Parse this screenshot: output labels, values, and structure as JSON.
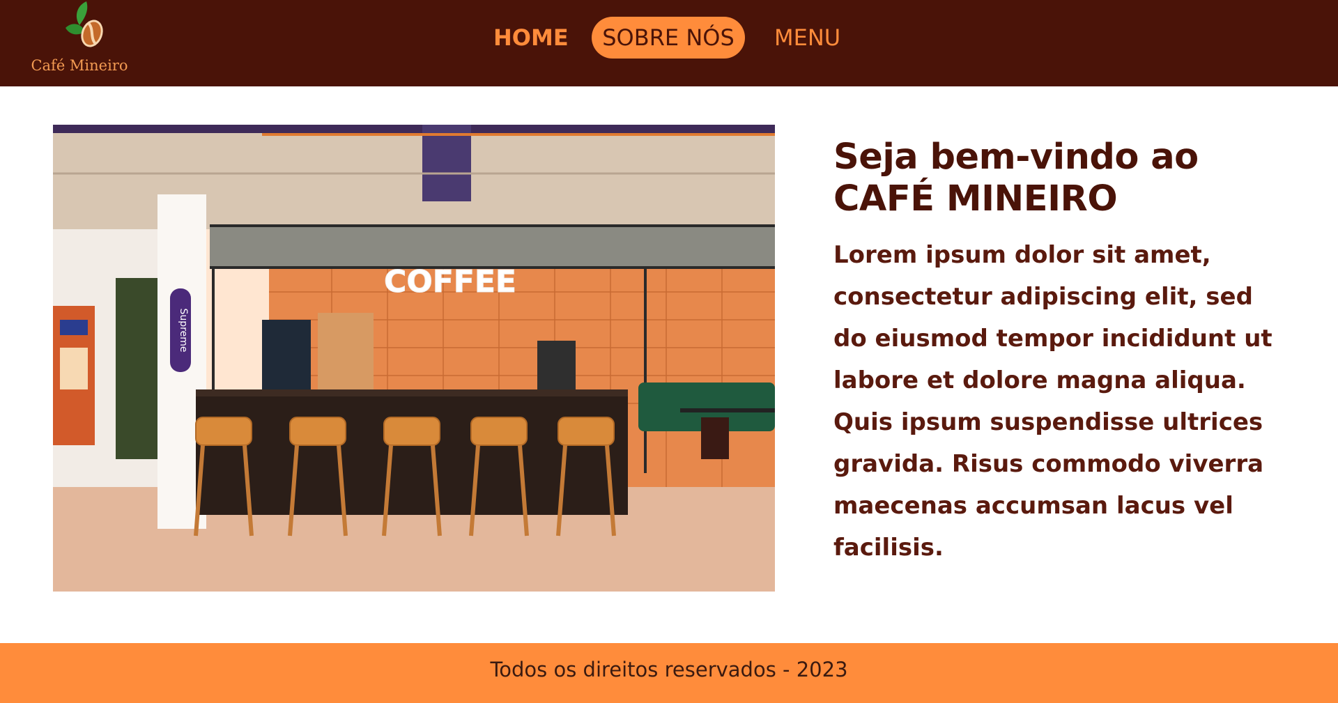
{
  "brand": {
    "name": "Café Mineiro",
    "logo_icon": "coffee-bean-leaf-icon"
  },
  "nav": {
    "items": [
      {
        "label": "HOME"
      },
      {
        "label": "SOBRE NÓS",
        "active": true
      },
      {
        "label": "MENU"
      }
    ]
  },
  "hero": {
    "image_sign": "COFFEE",
    "board_text": "Supreme",
    "title_line1": "Seja bem-vindo ao",
    "title_line2": "CAFÉ MINEIRO",
    "body": "Lorem ipsum dolor sit amet, consectetur adipiscing elit, sed do eiusmod tempor incididunt ut labore et dolore magna aliqua. Quis ipsum suspendisse ultrices gravida. Risus commodo viverra maecenas accumsan lacus vel facilisis."
  },
  "footer": {
    "text": "Todos os direitos reservados - 2023"
  },
  "colors": {
    "header_bg": "#4a1308",
    "accent": "#ff8c3b",
    "title": "#4a1308",
    "footer_bg": "#ff8c3b"
  }
}
